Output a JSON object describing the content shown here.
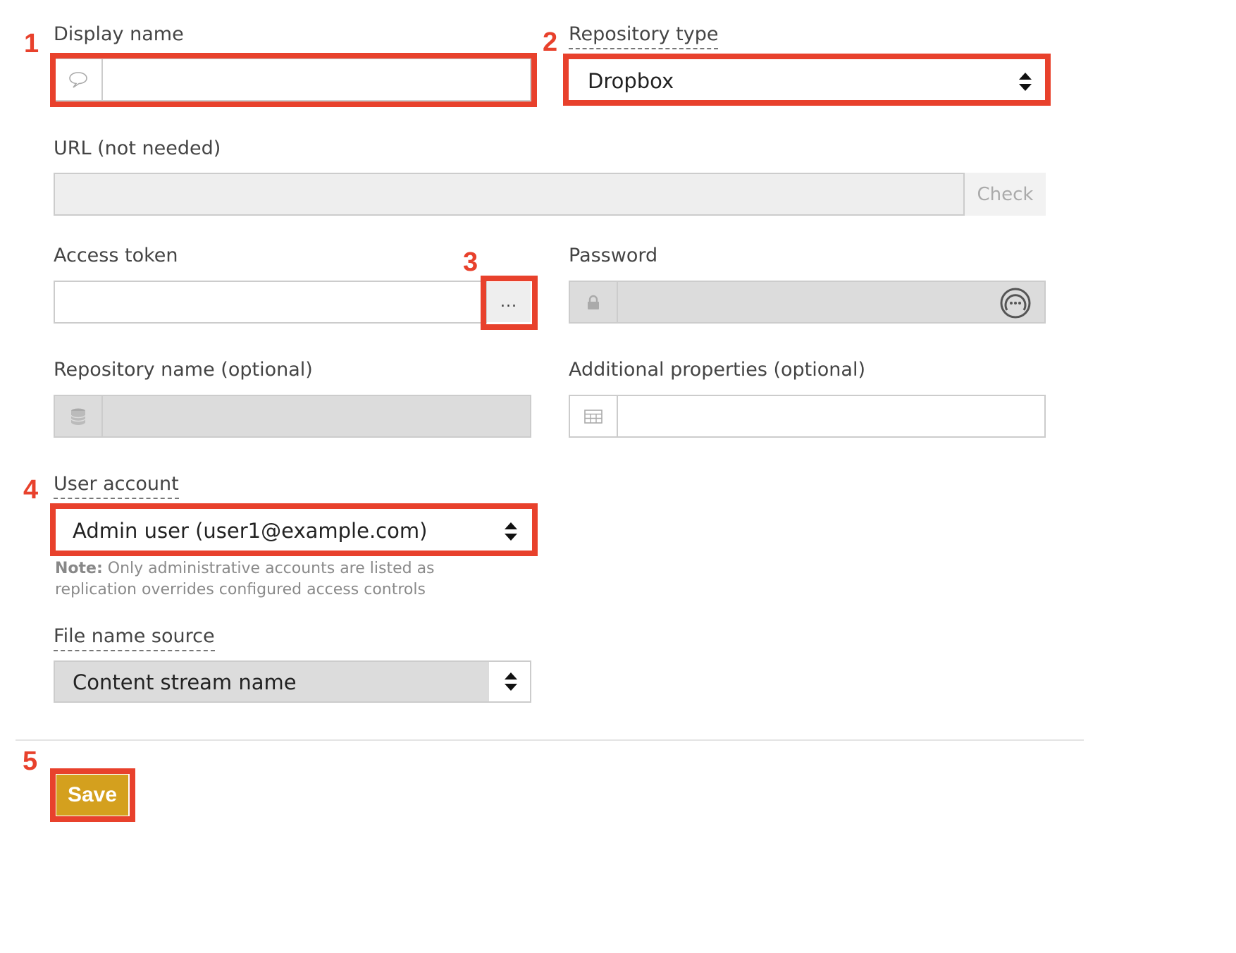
{
  "markers": [
    "1",
    "2",
    "3",
    "4",
    "5"
  ],
  "display_name": {
    "label": "Display name",
    "value": "",
    "icon": "speech-bubble-icon"
  },
  "repository_type": {
    "label": "Repository type",
    "selected": "Dropbox"
  },
  "url": {
    "label": "URL (not needed)",
    "value": "",
    "check_label": "Check"
  },
  "access_token": {
    "label": "Access token",
    "value": "",
    "browse_label": "..."
  },
  "password": {
    "label": "Password",
    "value": "",
    "icon": "lock-icon",
    "reveal_icon": "password-reveal-icon"
  },
  "repository_name": {
    "label": "Repository name (optional)",
    "value": "",
    "icon": "database-icon"
  },
  "additional_properties": {
    "label": "Additional properties (optional)",
    "value": "",
    "icon": "table-icon"
  },
  "user_account": {
    "label": "User account",
    "selected": "Admin user (user1@example.com)",
    "note_bold": "Note:",
    "note_text": " Only administrative accounts are listed as replication overrides configured access controls"
  },
  "file_name_source": {
    "label": "File name source",
    "selected": "Content stream name"
  },
  "save_label": "Save",
  "colors": {
    "highlight": "#e8412c",
    "save_button": "#d4a01e"
  }
}
